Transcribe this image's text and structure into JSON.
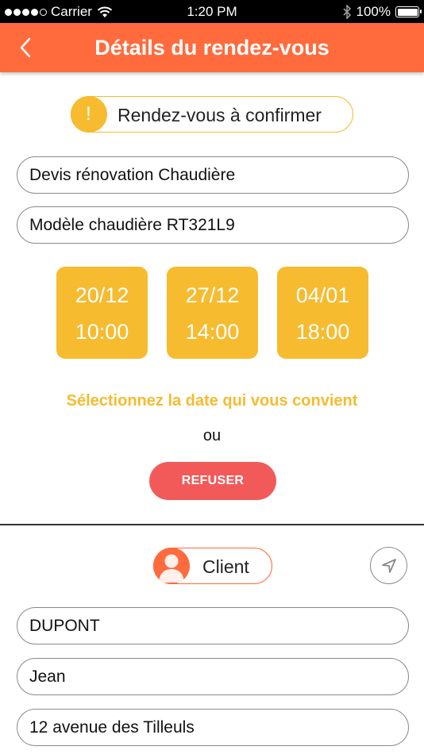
{
  "status_bar": {
    "carrier": "Carrier",
    "time": "1:20 PM",
    "battery": "100%",
    "signal_dots_filled": 4,
    "signal_dots_total": 5
  },
  "header": {
    "title": "Détails du rendez-vous",
    "back_icon": "chevron-left-icon",
    "color": "#ff6b3d"
  },
  "appointment_status": {
    "icon_text": "!",
    "label": "Rendez-vous à confirmer",
    "color": "#f6bb2f"
  },
  "appointment": {
    "subject": "Devis rénovation Chaudière",
    "model": "Modèle chaudière RT321L9"
  },
  "dates": [
    {
      "date": "20/12",
      "time": "10:00"
    },
    {
      "date": "27/12",
      "time": "14:00"
    },
    {
      "date": "04/01",
      "time": "18:00"
    }
  ],
  "instructions": {
    "select_text": "Sélectionnez la date qui vous convient",
    "or_text": "ou"
  },
  "refuse_button": {
    "label": "REFUSER",
    "color": "#f25a5a"
  },
  "client": {
    "label": "Client",
    "avatar_icon": "person-icon",
    "navigation_icon": "location-arrow-icon",
    "last_name": "DUPONT",
    "first_name": "Jean",
    "address": "12 avenue des Tilleuls"
  }
}
